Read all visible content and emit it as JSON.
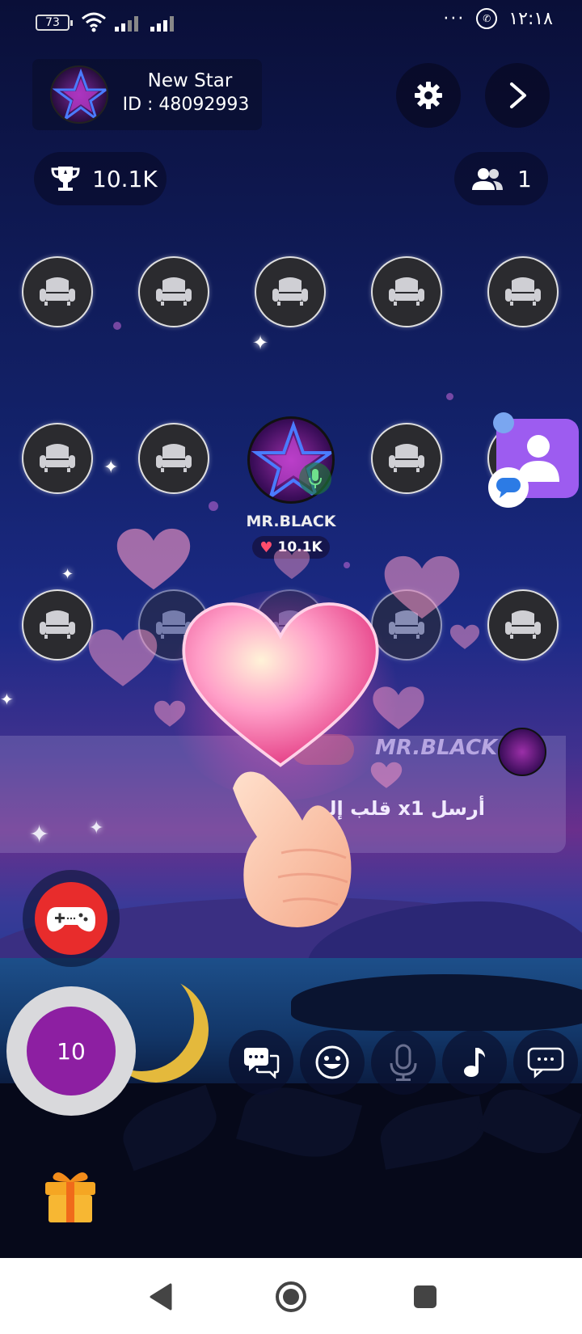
{
  "status_bar": {
    "battery": "73",
    "time": "١٢:١٨",
    "more": "···"
  },
  "room": {
    "name": "New Star",
    "id_line": "ID : 48092993",
    "avatar_text": "New"
  },
  "header": {
    "settings_icon": "gear-icon",
    "next_icon": "chevron-right-icon"
  },
  "stats": {
    "trophy_score": "10.1K",
    "members": "1"
  },
  "seats": {
    "occupied": {
      "name": "MR.BLACK",
      "score": "10.1K",
      "avatar_text": "New"
    }
  },
  "chat": {
    "user": "MR.BLACK",
    "message": "أرسل x1 قلب إلى"
  },
  "controls": {
    "counter": "10",
    "tools": [
      "chat-bubbles-icon",
      "emoji-icon",
      "mic-icon",
      "music-icon",
      "more-chat-icon"
    ]
  },
  "colors": {
    "accent_purple": "#8d1fa2",
    "game_red": "#e82c2c",
    "contact_purple": "#9d5cf0",
    "gift_orange": "#f5a623"
  }
}
